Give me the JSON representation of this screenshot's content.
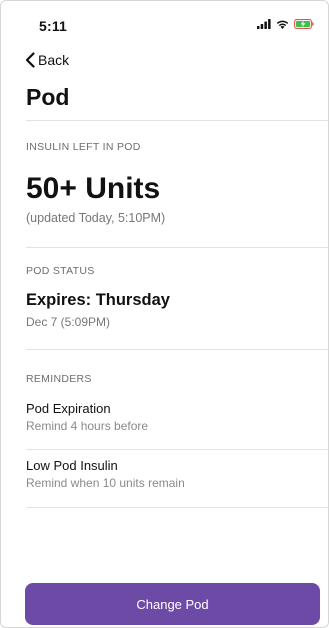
{
  "status_bar": {
    "time": "5:11"
  },
  "nav": {
    "back_label": "Back"
  },
  "page": {
    "title": "Pod"
  },
  "insulin": {
    "header": "INSULIN LEFT IN POD",
    "value": "50+ Units",
    "updated": "(updated Today, 5:10PM)"
  },
  "pod_status": {
    "header": "POD STATUS",
    "expires": "Expires: Thursday",
    "date": "Dec 7 (5:09PM)"
  },
  "reminders": {
    "header": "REMINDERS",
    "items": [
      {
        "title": "Pod Expiration",
        "subtitle": "Remind 4 hours before"
      },
      {
        "title": "Low Pod Insulin",
        "subtitle": "Remind when 10 units remain"
      }
    ]
  },
  "actions": {
    "change_pod_label": "Change Pod"
  },
  "colors": {
    "accent": "#6d4aa6",
    "battery_charge": "#36c24b",
    "battery_border": "#e0564a"
  },
  "icons": {
    "signal": "cellular-signal-icon",
    "wifi": "wifi-icon",
    "battery": "battery-charging-icon",
    "back": "chevron-left-icon"
  }
}
